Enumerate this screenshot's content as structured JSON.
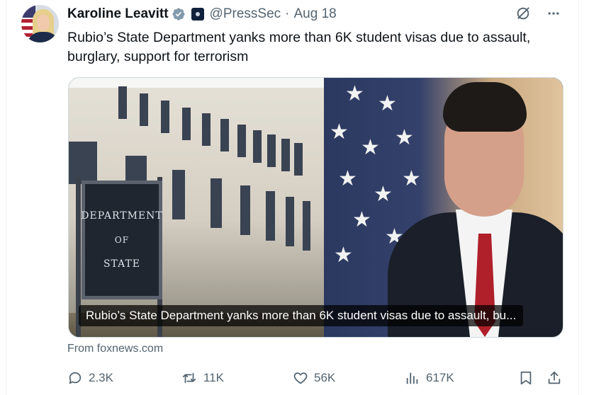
{
  "tweet": {
    "author": {
      "name": "Karoline Leavitt",
      "handle": "@PressSec",
      "date": "Aug 18",
      "separator": "·",
      "avatar_icon": "avatar-photo",
      "verified_color": "#829aab"
    },
    "text": "Rubio’s State Department yanks more than 6K student visas due to assault, burglary, support for terrorism",
    "card": {
      "caption": "Rubio’s State Department yanks more than 6K student visas due to assault, bu...",
      "sign_lines": [
        "DEPARTMENT",
        "OF",
        "STATE"
      ],
      "source": "From foxnews.com"
    },
    "stats": {
      "replies": "2.3K",
      "reposts": "11K",
      "likes": "56K",
      "views": "617K"
    }
  },
  "icons": {
    "grok": "grok-icon",
    "more": "more-icon",
    "reply": "reply-icon",
    "repost": "repost-icon",
    "like": "heart-icon",
    "views": "views-icon",
    "bookmark": "bookmark-icon",
    "share": "share-icon"
  },
  "colors": {
    "text": "#0f1419",
    "secondary": "#536471",
    "border": "#cfd9de"
  }
}
